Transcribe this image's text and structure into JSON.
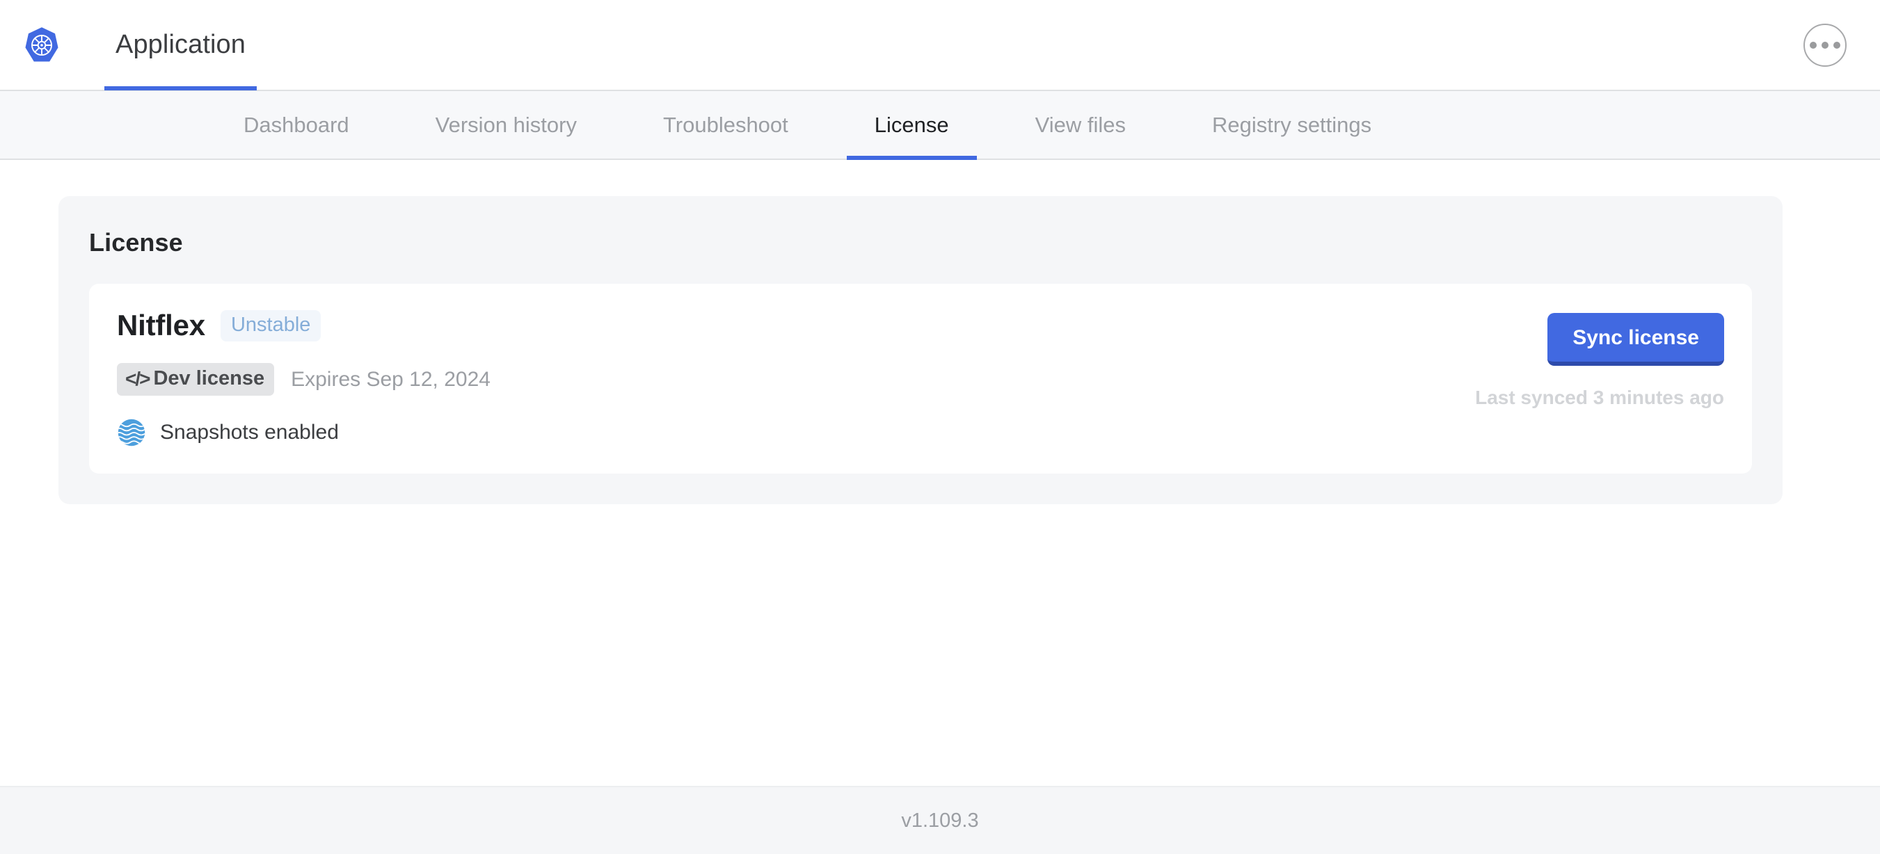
{
  "header": {
    "logo_icon": "kubernetes-logo-icon",
    "app_tab_label": "Application",
    "menu_icon": "kebab-menu-icon",
    "accent_color": "#4169e1"
  },
  "subnav": {
    "items": [
      {
        "label": "Dashboard",
        "active": false
      },
      {
        "label": "Version history",
        "active": false
      },
      {
        "label": "Troubleshoot",
        "active": false
      },
      {
        "label": "License",
        "active": true
      },
      {
        "label": "View files",
        "active": false
      },
      {
        "label": "Registry settings",
        "active": false
      }
    ]
  },
  "license_panel": {
    "title": "License",
    "card": {
      "name": "Nitflex",
      "channel_badge": "Unstable",
      "type_badge": {
        "icon": "code-brackets-icon",
        "label": "Dev license"
      },
      "expires": "Expires Sep 12, 2024",
      "feature": {
        "icon": "snapshots-waves-icon",
        "label": "Snapshots enabled"
      },
      "sync_button_label": "Sync license",
      "last_synced": "Last synced 3 minutes ago"
    }
  },
  "footer": {
    "version": "v1.109.3"
  }
}
